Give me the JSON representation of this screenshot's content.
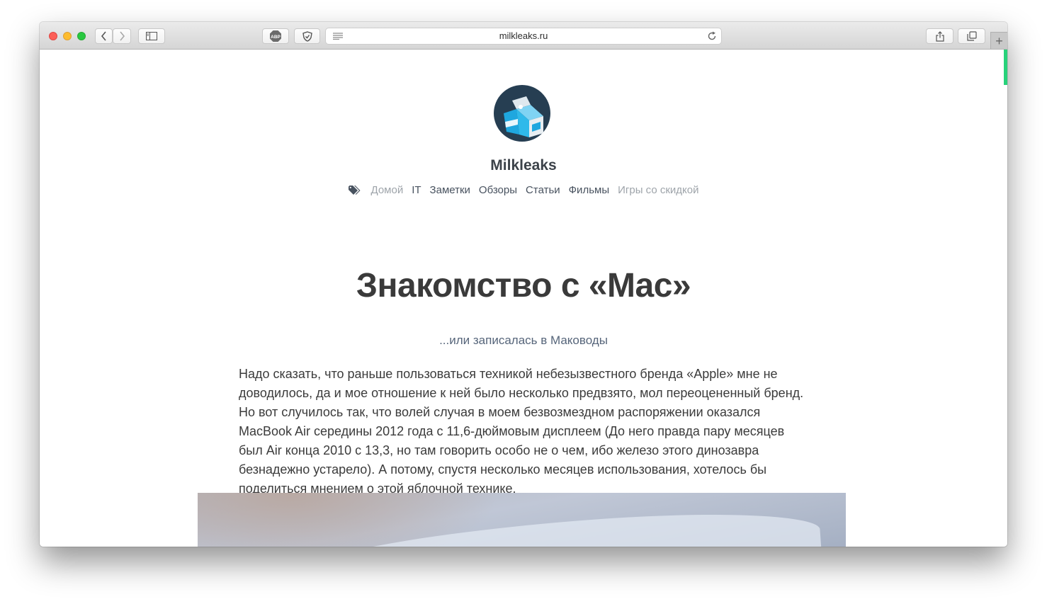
{
  "browser": {
    "url": "milkleaks.ru",
    "icons": {
      "back": "chevron-left-icon",
      "forward": "chevron-right-icon",
      "sidebar": "sidebar-icon",
      "adblock": "abp-icon",
      "shield": "shield-icon",
      "reader": "reader-icon",
      "reload": "reload-icon",
      "share": "share-icon",
      "tabs": "tabs-icon",
      "new_tab": "+"
    },
    "adblock_label": "ABP"
  },
  "site": {
    "title": "Milkleaks",
    "nav": [
      {
        "label": "Домой",
        "muted": true
      },
      {
        "label": "IT",
        "muted": false
      },
      {
        "label": "Заметки",
        "muted": false
      },
      {
        "label": "Обзоры",
        "muted": false
      },
      {
        "label": "Статьи",
        "muted": false
      },
      {
        "label": "Фильмы",
        "muted": false
      },
      {
        "label": "Игры со скидкой",
        "muted": true
      }
    ]
  },
  "post": {
    "title": "Знакомство с «Mac»",
    "subtitle": "...или записалась в Маководы",
    "body": "Надо сказать, что раньше пользоваться техникой небезызвестного бренда «Apple» мне не доводилось, да и мое отношение к ней было несколько предвзято, мол переоцененный бренд. Но вот случилось так, что волей случая в моем безвозмездном распоряжении оказался MacBook Air середины 2012 года с 11,6-дюймовым дисплеем (До него правда пару месяцев был Air конца 2010 с 13,3, но там говорить особо не о чем, ибо железо этого динозавра безнадежно устарело). А потому, спустя несколько месяцев использования, хотелось бы поделиться мнением о этой яблочной технике."
  },
  "colors": {
    "accent_scroll": "#27d27a",
    "nav_text": "#48525f",
    "nav_muted": "#9ea4aa",
    "title_text": "#3a3a3a",
    "subtitle_text": "#56657a"
  }
}
